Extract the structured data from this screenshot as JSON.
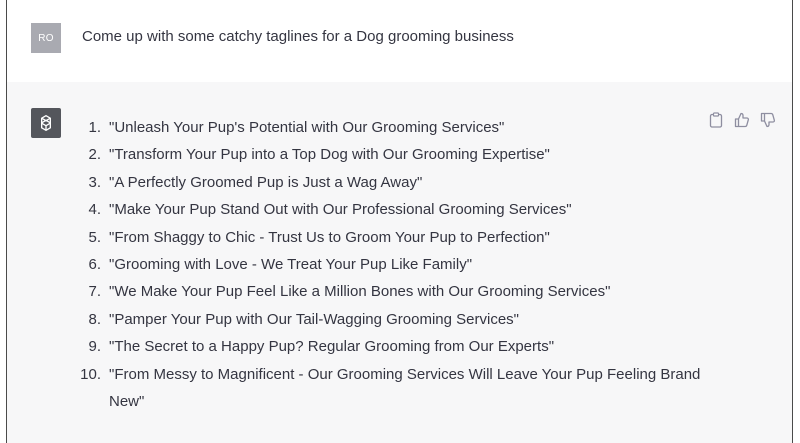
{
  "user_message": {
    "avatar_initials": "RO",
    "text": "Come up with some catchy taglines for a Dog grooming business"
  },
  "assistant_message": {
    "avatar_icon": "openai-logo-icon",
    "items": [
      {
        "num": "1.",
        "text": "\"Unleash Your Pup's Potential with Our Grooming Services\""
      },
      {
        "num": "2.",
        "text": "\"Transform Your Pup into a Top Dog with Our Grooming Expertise\""
      },
      {
        "num": "3.",
        "text": "\"A Perfectly Groomed Pup is Just a Wag Away\""
      },
      {
        "num": "4.",
        "text": "\"Make Your Pup Stand Out with Our Professional Grooming Services\""
      },
      {
        "num": "5.",
        "text": "\"From Shaggy to Chic - Trust Us to Groom Your Pup to Perfection\""
      },
      {
        "num": "6.",
        "text": "\"Grooming with Love - We Treat Your Pup Like Family\""
      },
      {
        "num": "7.",
        "text": "\"We Make Your Pup Feel Like a Million Bones with Our Grooming Services\""
      },
      {
        "num": "8.",
        "text": "\"Pamper Your Pup with Our Tail-Wagging Grooming Services\""
      },
      {
        "num": "9.",
        "text": "\"The Secret to a Happy Pup? Regular Grooming from Our Experts\""
      },
      {
        "num": "10.",
        "text": "\"From Messy to Magnificent - Our Grooming Services Will Leave Your Pup Feeling Brand New\""
      }
    ],
    "actions": [
      "clipboard-icon",
      "thumbs-up-icon",
      "thumbs-down-icon"
    ]
  },
  "colors": {
    "user_avatar_bg": "#a9aab1",
    "bot_avatar_bg": "#54565c",
    "assistant_row_bg": "#f7f7f8",
    "text": "#343541",
    "icon": "#8e8ea0"
  }
}
